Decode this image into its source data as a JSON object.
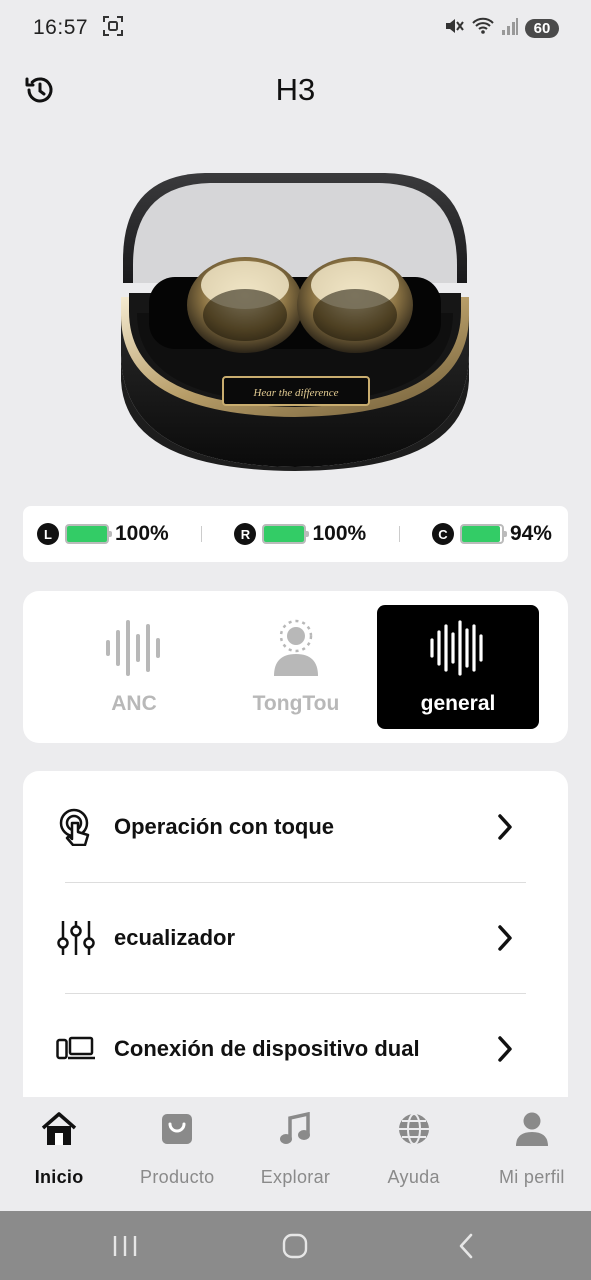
{
  "status_bar": {
    "time": "16:57",
    "battery": "60"
  },
  "header": {
    "title": "H3"
  },
  "battery": {
    "items": [
      {
        "letter": "L",
        "level": 1.0,
        "text": "100%"
      },
      {
        "letter": "R",
        "level": 1.0,
        "text": "100%"
      },
      {
        "letter": "C",
        "level": 0.94,
        "text": "94%"
      }
    ],
    "fill_color": "#33cc66"
  },
  "product_image": {
    "plate_text": "Hear the difference"
  },
  "modes": [
    {
      "label": "ANC",
      "icon": "sound-wave-icon",
      "active": false
    },
    {
      "label": "TongTou",
      "icon": "ambient-person-icon",
      "active": false
    },
    {
      "label": "general",
      "icon": "sound-wave-dense-icon",
      "active": true
    }
  ],
  "menu": [
    {
      "label": "Operación con toque",
      "icon": "touch-icon"
    },
    {
      "label": "ecualizador",
      "icon": "equalizer-icon"
    },
    {
      "label": "Conexión de dispositivo dual",
      "icon": "dual-device-icon"
    }
  ],
  "nav": [
    {
      "label": "Inicio",
      "icon": "home-icon",
      "active": true
    },
    {
      "label": "Producto",
      "icon": "shopping-bag-icon",
      "active": false
    },
    {
      "label": "Explorar",
      "icon": "music-note-icon",
      "active": false
    },
    {
      "label": "Ayuda",
      "icon": "globe-icon",
      "active": false
    },
    {
      "label": "Mi perfil",
      "icon": "person-icon",
      "active": false
    }
  ]
}
